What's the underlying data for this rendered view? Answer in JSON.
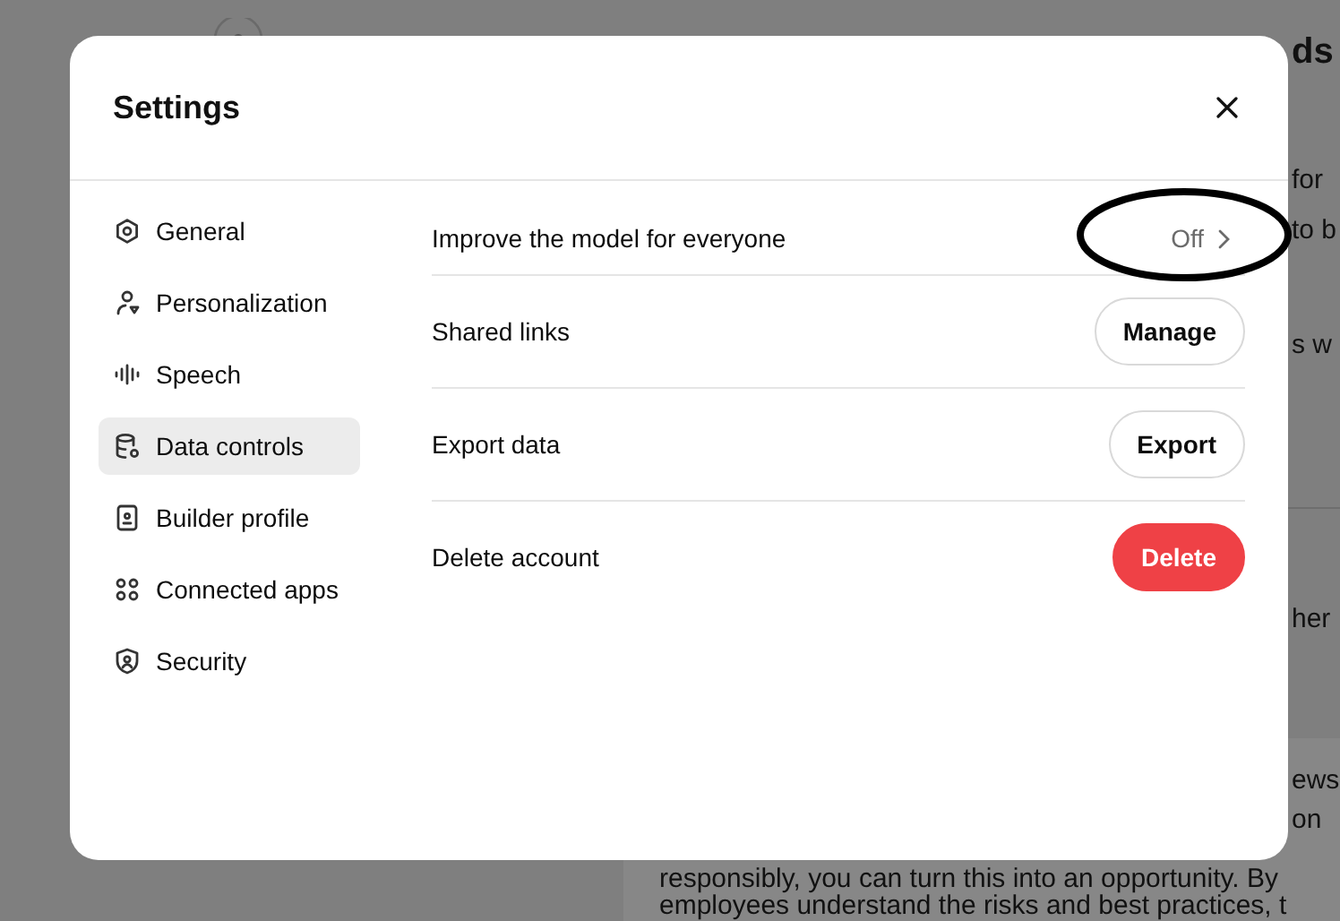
{
  "background": {
    "heading_fragment": "ds",
    "fragments": [
      "for",
      "to b",
      "s w",
      "her",
      "ews",
      "on"
    ],
    "paragraph_lines": [
      "responsibly, you can turn this into an opportunity. By",
      "employees understand the risks and best practices, t"
    ]
  },
  "dialog": {
    "title": "Settings",
    "sidebar": [
      {
        "label": "General",
        "selected": false
      },
      {
        "label": "Personalization",
        "selected": false
      },
      {
        "label": "Speech",
        "selected": false
      },
      {
        "label": "Data controls",
        "selected": true
      },
      {
        "label": "Builder profile",
        "selected": false
      },
      {
        "label": "Connected apps",
        "selected": false
      },
      {
        "label": "Security",
        "selected": false
      }
    ],
    "rows": [
      {
        "label": "Improve the model for everyone",
        "kind": "link",
        "value": "Off"
      },
      {
        "label": "Shared links",
        "kind": "button",
        "button": "Manage"
      },
      {
        "label": "Export data",
        "kind": "button",
        "button": "Export"
      },
      {
        "label": "Delete account",
        "kind": "danger",
        "button": "Delete"
      }
    ]
  }
}
